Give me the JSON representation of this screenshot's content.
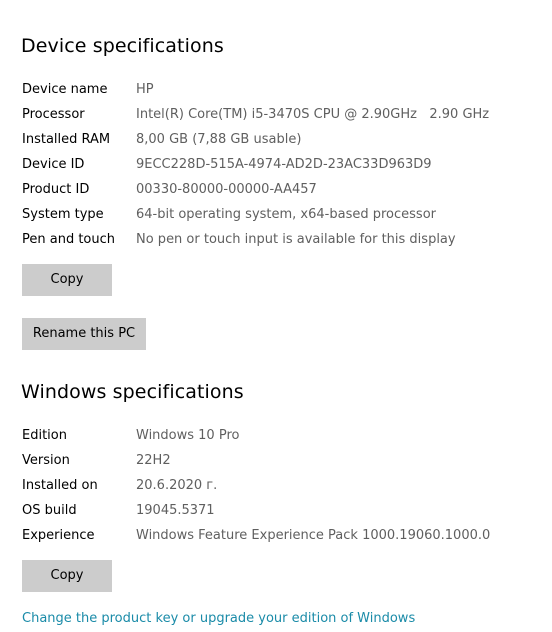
{
  "device_specs": {
    "title": "Device specifications",
    "rows": [
      {
        "label": "Device name",
        "value": "HP"
      },
      {
        "label": "Processor",
        "value": "Intel(R) Core(TM) i5-3470S CPU @ 2.90GHz   2.90 GHz"
      },
      {
        "label": "Installed RAM",
        "value": "8,00 GB (7,88 GB usable)"
      },
      {
        "label": "Device ID",
        "value": "9ECC228D-515A-4974-AD2D-23AC33D963D9"
      },
      {
        "label": "Product ID",
        "value": "00330-80000-00000-AA457"
      },
      {
        "label": "System type",
        "value": "64-bit operating system, x64-based processor"
      },
      {
        "label": "Pen and touch",
        "value": "No pen or touch input is available for this display"
      }
    ],
    "copy_label": "Copy",
    "rename_label": "Rename this PC"
  },
  "windows_specs": {
    "title": "Windows specifications",
    "rows": [
      {
        "label": "Edition",
        "value": "Windows 10 Pro"
      },
      {
        "label": "Version",
        "value": "22H2"
      },
      {
        "label": "Installed on",
        "value": "20.6.2020 г."
      },
      {
        "label": "OS build",
        "value": "19045.5371"
      },
      {
        "label": "Experience",
        "value": "Windows Feature Experience Pack 1000.19060.1000.0"
      }
    ],
    "copy_label": "Copy"
  },
  "product_key_link": "Change the product key or upgrade your edition of Windows"
}
